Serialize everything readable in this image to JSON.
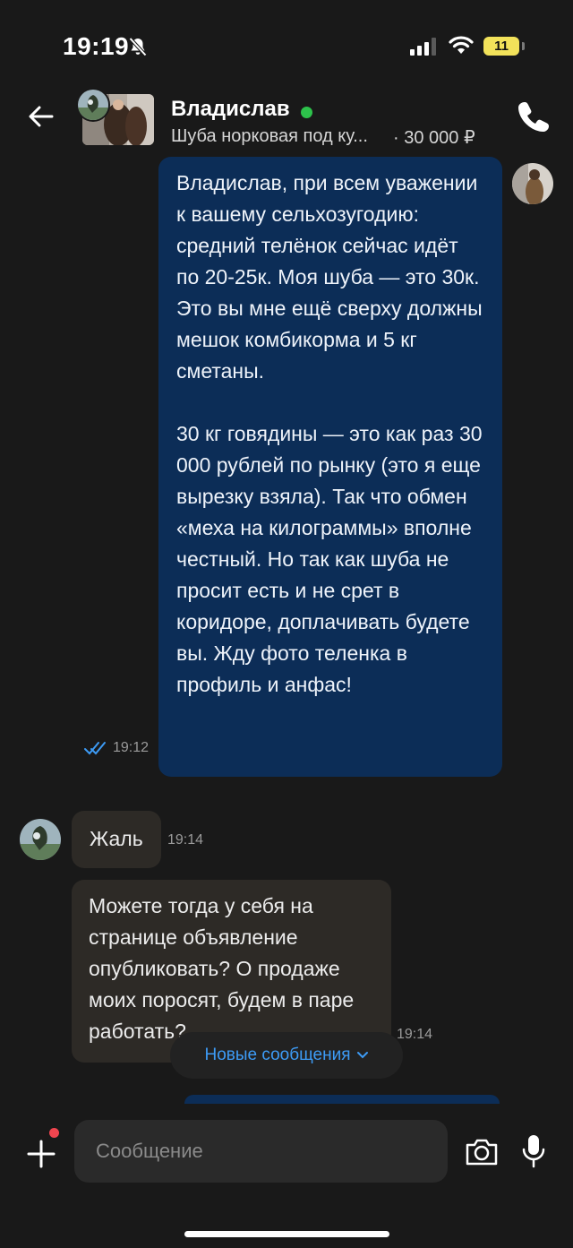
{
  "status_bar": {
    "time": "19:19",
    "battery": "11",
    "icons": [
      "bell-slash-icon",
      "signal-icon",
      "wifi-icon",
      "battery-icon"
    ]
  },
  "header": {
    "contact_name": "Владислав",
    "online": true,
    "listing_title": "Шуба норковая под ку...",
    "listing_price": "· 30 000 ₽",
    "icons": [
      "back-arrow-icon",
      "phone-icon"
    ]
  },
  "messages": {
    "outgoing": {
      "paragraphs": [
        "Владислав, при всем уважении к вашему сельхозугодию: средний телёнок сейчас идёт по 20-25к. Моя шуба — это 30к. Это вы мне ещё сверху должны мешок комбикорма и 5 кг сметаны.",
        "30 кг говядины — это как раз 30 000 рублей по рынку (это я еще вырезку взяла). Так что обмен «меха на килограммы» вполне честный. Но так как шуба не просит есть и не срет в коридоре, доплачивать будете вы. Жду фото теленка в профиль и анфас!"
      ],
      "time": "19:12",
      "status": "read"
    },
    "incoming": [
      {
        "text": "Жаль",
        "time": "19:14"
      },
      {
        "text": "Можете тогда у себя на странице объявление опубликовать? О продаже моих поросят, будем в паре работать?",
        "time": "19:14"
      }
    ]
  },
  "new_messages_label": "Новые сообщения",
  "composer": {
    "placeholder": "Сообщение",
    "value": "",
    "icons": [
      "plus-icon",
      "camera-icon",
      "microphone-icon"
    ]
  },
  "colors": {
    "background": "#191919",
    "outgoing_bubble": "#0c2d57",
    "incoming_bubble": "#2d2a26",
    "accent": "#3d9bf5",
    "online": "#2dc24b",
    "notification_dot": "#f0454f"
  }
}
